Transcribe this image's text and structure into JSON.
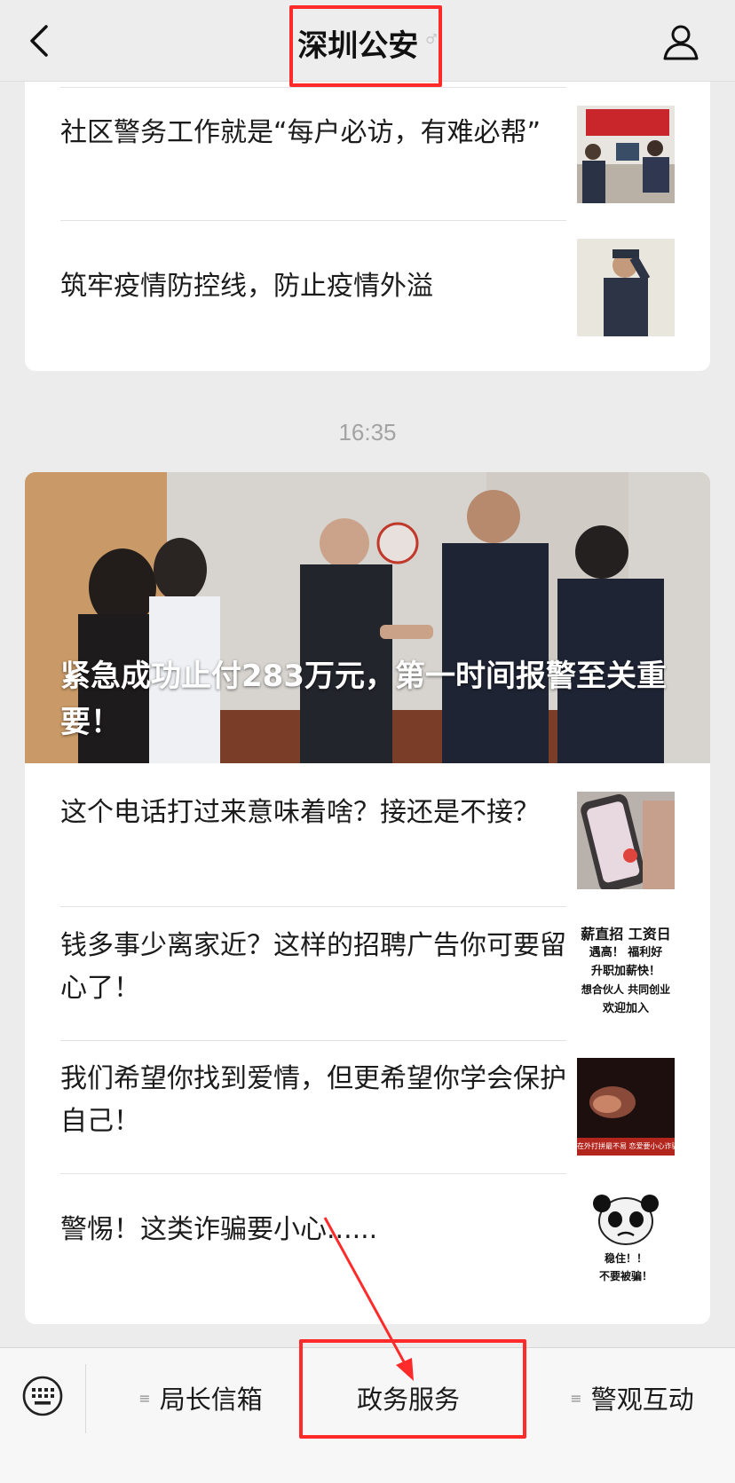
{
  "nav": {
    "title": "深圳公安",
    "back_icon": "chevron-left-icon",
    "profile_icon": "person-icon",
    "verified_mark": "♂"
  },
  "top_card": {
    "items": [
      {
        "title": "社区警务工作就是“每户必访，有难必帮”"
      },
      {
        "title": "筑牢疫情防控线，防止疫情外溢"
      }
    ]
  },
  "timestamp": "16:35",
  "main_card": {
    "hero_title": "紧急成功止付283万元，第一时间报警至关重要！",
    "items": [
      {
        "title": "这个电话打过来意味着啥？接还是不接？"
      },
      {
        "title": "钱多事少离家近？这样的招聘广告你可要留心了！",
        "thumb_lines": [
          "薪直招 工资日",
          "遇高！ 福利好",
          "升职加薪快！",
          "想合伙人 共同创业",
          "欢迎加入"
        ]
      },
      {
        "title": "我们希望你找到爱情，但更希望你学会保护自己！",
        "thumb_caption": "在外打拼最不易 恋爱要小心诈骗"
      },
      {
        "title": "警惕！这类诈骗要小心......",
        "thumb_lines": [
          "稳住！！",
          "不要被骗！"
        ]
      }
    ]
  },
  "bottom_menu": {
    "keyboard_icon": "keyboard-icon",
    "items": [
      {
        "label": "局长信箱",
        "lines": "≡"
      },
      {
        "label": "政务服务"
      },
      {
        "label": "警观互动",
        "lines": "≡"
      }
    ]
  },
  "colors": {
    "annotation": "#ff2b2b",
    "background": "#ececec",
    "card": "#ffffff"
  }
}
